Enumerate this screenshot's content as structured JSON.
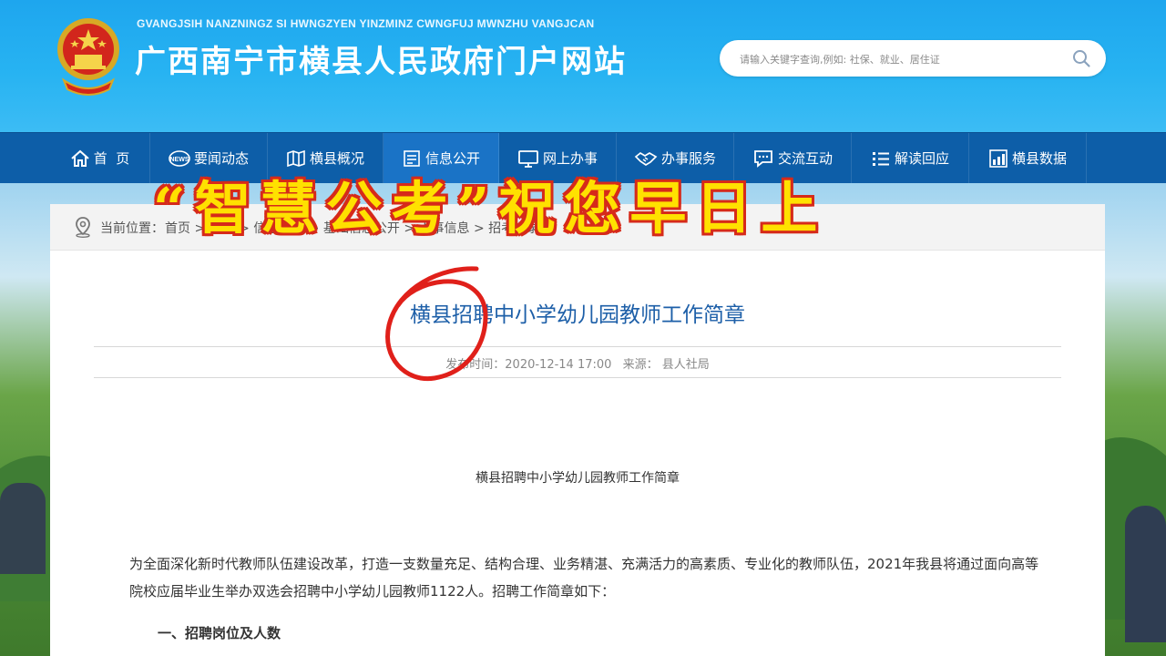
{
  "header": {
    "subtitle": "GVANGJSIH NANZNINGZ SI HWNGZYEN YINZMINZ CWNGFUJ MWNZHU VANGJCAN",
    "title": "广西南宁市横县人民政府门户网站",
    "search_placeholder": "请输入关键字查询,例如: 社保、就业、居住证"
  },
  "nav": {
    "items": [
      {
        "label": "首  页",
        "icon": "home-icon"
      },
      {
        "label": "要闻动态",
        "icon": "news-icon"
      },
      {
        "label": "横县概况",
        "icon": "map-icon"
      },
      {
        "label": "信息公开",
        "icon": "document-icon",
        "active": true
      },
      {
        "label": "网上办事",
        "icon": "monitor-icon"
      },
      {
        "label": "办事服务",
        "icon": "handshake-icon"
      },
      {
        "label": "交流互动",
        "icon": "chat-icon"
      },
      {
        "label": "解读回应",
        "icon": "list-icon"
      },
      {
        "label": "横县数据",
        "icon": "bar-chart-icon"
      }
    ]
  },
  "breadcrumb": {
    "label": "当前位置：",
    "path": "首页 > 公开 > 信息公开 > 基础信息公开 > 人事信息 > 招考招录"
  },
  "article": {
    "title": "横县招聘中小学幼儿园教师工作简章",
    "publish_time": "发布时间：2020-12-14 17:00",
    "source": "来源：  县人社局",
    "inner_title": "横县招聘中小学幼儿园教师工作简章",
    "paragraph": "为全面深化新时代教师队伍建设改革，打造一支数量充足、结构合理、业务精湛、充满活力的高素质、专业化的教师队伍，2021年我县将通过面向高等院校应届毕业生举办双选会招聘中小学幼儿园教师1122人。招聘工作简章如下：",
    "section_heading": "一、招聘岗位及人数"
  },
  "overlay": {
    "caption": "“智慧公考”祝您早日上"
  },
  "colors": {
    "header_blue": "#27b3f2",
    "nav_blue": "#0d5ea8",
    "nav_active": "#1a73c6",
    "title_blue": "#1d5fa8",
    "overlay_yellow": "#ffe100",
    "overlay_red": "#d62a1a"
  }
}
